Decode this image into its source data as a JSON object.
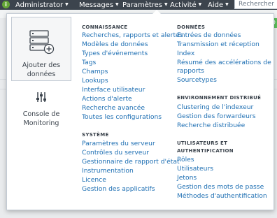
{
  "topbar": {
    "info_icon": "info-icon",
    "menus": [
      {
        "label": "Administrator"
      },
      {
        "label": "Messages"
      },
      {
        "label": "Paramètres"
      },
      {
        "label": "Activité"
      },
      {
        "label": "Aide"
      }
    ],
    "search_placeholder": "Rechercher"
  },
  "dropdown": {
    "side_tiles": [
      {
        "label_line1": "Ajouter des",
        "label_line2": "données",
        "icon": "server-add-icon"
      },
      {
        "label_line1": "Console de",
        "label_line2": "Monitoring",
        "icon": "sliders-icon"
      }
    ],
    "sections": {
      "knowledge": {
        "heading": "CONNAISSANCE",
        "items": [
          "Recherches, rapports et alertes",
          "Modèles de données",
          "Types d'événements",
          "Tags",
          "Champs",
          "Lookups",
          "Interface utilisateur",
          "Actions d'alerte",
          "Recherche avancée",
          "Toutes les configurations"
        ]
      },
      "system": {
        "heading": "SYSTÈME",
        "items": [
          "Paramètres du serveur",
          "Contrôles du serveur",
          "Gestionnaire de rapport d'état",
          "Instrumentation",
          "Licence",
          "Gestion des applicatifs"
        ]
      },
      "data": {
        "heading": "DONNÉES",
        "items": [
          "Entrées de données",
          "Transmission et réception",
          "Index",
          "Résumé des accélérations de",
          "rapports",
          "Sourcetypes"
        ]
      },
      "distributed": {
        "heading": "ENVIRONNEMENT DISTRIBUÉ",
        "items": [
          "Clustering de l'indexeur",
          "Gestion des forwardeurs",
          "Recherche distribuée"
        ]
      },
      "users": {
        "heading_line1": "UTILISATEURS ET",
        "heading_line2": "AUTHENTIFICATION",
        "items": [
          "Rôles",
          "Utilisateurs",
          "Jetons",
          "Gestion des mots de passe",
          "Méthodes d'authentification"
        ]
      }
    }
  },
  "colors": {
    "topbar_bg": "#3c444d",
    "link": "#1e6fb3",
    "accent_green": "#65a637"
  }
}
